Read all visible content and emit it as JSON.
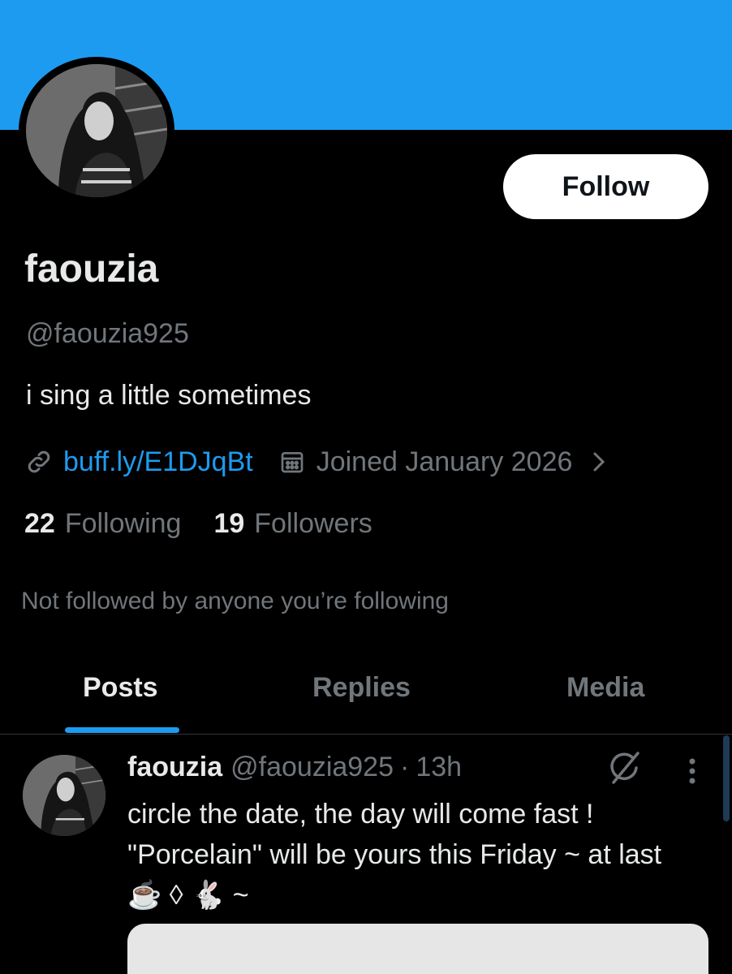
{
  "colors": {
    "banner": "#1d9bf0",
    "accent": "#1d9bf0",
    "text_primary": "#e7e9ea",
    "text_secondary": "#71767b",
    "background": "#000000"
  },
  "profile": {
    "display_name": "faouzia",
    "handle": "@faouzia925",
    "bio": "i sing a little sometimes",
    "link_icon": "link-icon",
    "link": "buff.ly/E1DJqBt",
    "calendar_icon": "calendar-icon",
    "joined": "Joined January 2026",
    "follow_label": "Follow"
  },
  "stats": {
    "following_count": "22",
    "following_label": "Following",
    "followers_count": "19",
    "followers_label": "Followers"
  },
  "mutuals_text": "Not followed by anyone you’re following",
  "tabs": [
    {
      "label": "Posts",
      "active": true
    },
    {
      "label": "Replies",
      "active": false
    },
    {
      "label": "Media",
      "active": false
    }
  ],
  "post": {
    "author_name": "faouzia",
    "author_handle": "@faouzia925",
    "separator": "·",
    "time": "13h",
    "text": "circle the date, the day will come fast ! \"Porcelain\" will be yours this Friday ~ at last ☕️ ◊ 🐇 ~",
    "icons": [
      "grok-icon",
      "more-vertical-icon"
    ]
  }
}
